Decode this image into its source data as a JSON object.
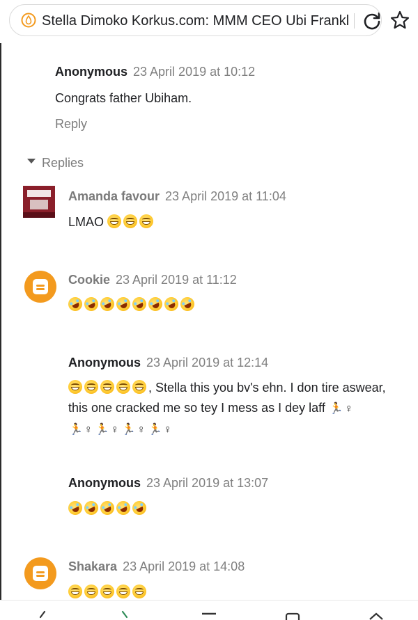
{
  "browser": {
    "url_title": "Stella Dimoko Korkus.com: MMM CEO Ubi Franklin",
    "icon_site": "site-logo-icon",
    "icon_reload": "reload-icon",
    "icon_bookmark": "star-icon"
  },
  "comments": [
    {
      "author": "Anonymous",
      "date": "23 April 2019 at 10:12",
      "text": "Congrats father Ubiham.",
      "reply_label": "Reply"
    }
  ],
  "replies_label": "Replies",
  "replies": [
    {
      "author": "Amanda favour",
      "date": "23 April 2019 at 11:04",
      "text": "LMAO",
      "avatar": "profile-photo"
    },
    {
      "author": "Cookie",
      "date": "23 April 2019 at 11:12",
      "text": "",
      "avatar": "blogger-icon"
    },
    {
      "author": "Anonymous",
      "date": "23 April 2019 at 12:14",
      "text_line1": ", Stella this you bv's ehn. I don tire aswear,",
      "text_line2": "this one cracked me so tey I mess as I dey laff"
    },
    {
      "author": "Anonymous",
      "date": "23 April 2019 at 13:07",
      "text": ""
    },
    {
      "author": "Shakara",
      "date": "23 April 2019 at 14:08",
      "text": "",
      "avatar": "blogger-icon"
    }
  ],
  "colors": {
    "author_gray": "#7a7a7a",
    "date_gray": "#808080",
    "blogger_orange": "#f39a1e"
  }
}
